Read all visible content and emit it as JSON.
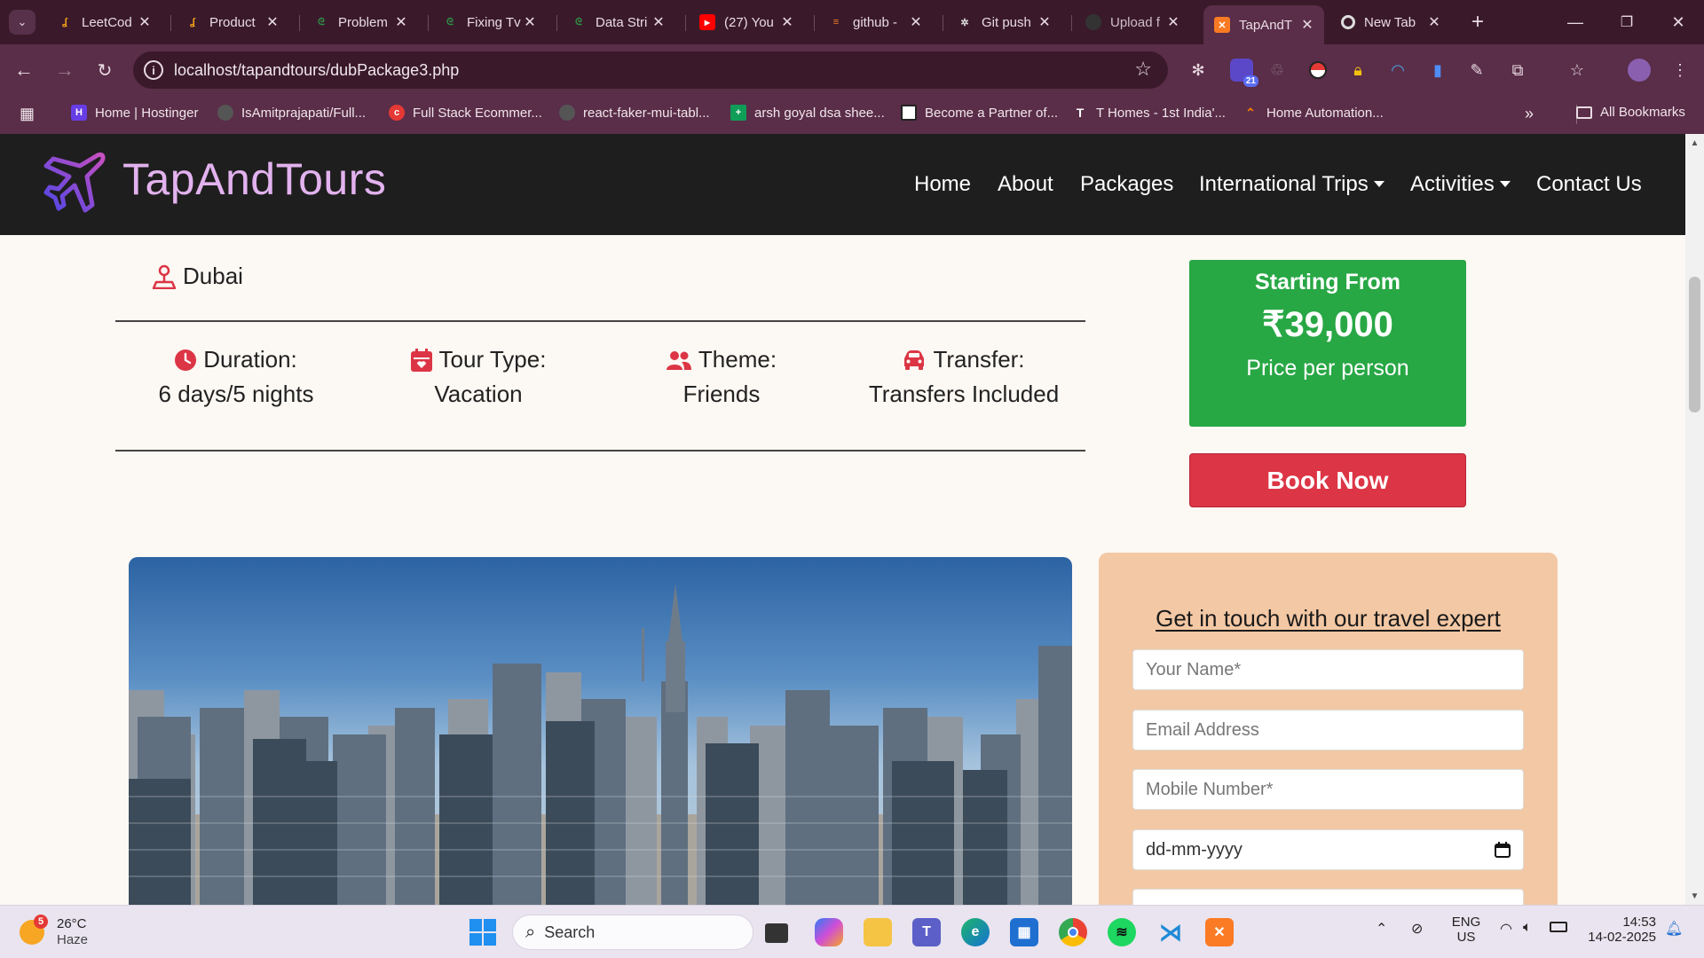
{
  "browser": {
    "tabs": [
      {
        "title": "LeetCod",
        "favicon": "leetcode-icon",
        "color": "#f7a21b"
      },
      {
        "title": "Product",
        "favicon": "leetcode-icon",
        "color": "#f7a21b"
      },
      {
        "title": "Problem",
        "favicon": "gfg-icon",
        "color": "#2f8d46"
      },
      {
        "title": "Fixing Tv",
        "favicon": "gfg-icon",
        "color": "#2f8d46"
      },
      {
        "title": "Data Stri",
        "favicon": "gfg-icon",
        "color": "#2f8d46"
      },
      {
        "title": "(27) You",
        "favicon": "youtube-icon",
        "color": "#ff0000"
      },
      {
        "title": "github -",
        "favicon": "stackoverflow-icon",
        "color": "#f48024"
      },
      {
        "title": "Git push",
        "favicon": "chatgpt-icon",
        "color": "#dddddd"
      },
      {
        "title": "Upload f",
        "favicon": "github-icon",
        "color": "#333333"
      },
      {
        "title": "TapAndT",
        "favicon": "xampp-icon",
        "color": "#fb7a24"
      },
      {
        "title": "New Tab",
        "favicon": "chrome-icon",
        "color": "#dddddd"
      }
    ],
    "url": "localhost/tapandtours/dubPackage3.php",
    "extension_badge": "21",
    "bookmarks": [
      {
        "label": "Home | Hostinger",
        "icon": "hostinger-icon",
        "color": "#673de6"
      },
      {
        "label": "IsAmitprajapati/Full...",
        "icon": "github-icon",
        "color": "#555555"
      },
      {
        "label": "Full Stack Ecommer...",
        "icon": "red-circle-icon",
        "color": "#e53935"
      },
      {
        "label": "react-faker-mui-tabl...",
        "icon": "github-icon",
        "color": "#555555"
      },
      {
        "label": "arsh goyal dsa shee...",
        "icon": "sheets-icon",
        "color": "#0f9d58"
      },
      {
        "label": "Become a Partner of...",
        "icon": "partner-icon",
        "color": "#222222"
      },
      {
        "label": "T Homes - 1st India'...",
        "icon": "thomes-icon",
        "color": "#111111"
      },
      {
        "label": "Home Automation...",
        "icon": "home-automation-icon",
        "color": "#f57c00"
      }
    ],
    "all_bookmarks_label": "All Bookmarks"
  },
  "site": {
    "brand": "TapAndTours",
    "nav": [
      "Home",
      "About",
      "Packages",
      "International Trips",
      "Activities",
      "Contact Us"
    ]
  },
  "package": {
    "location": "Dubai",
    "details": [
      {
        "icon": "clock-icon",
        "label": "Duration:",
        "value": "6 days/5 nights"
      },
      {
        "icon": "calendar-icon",
        "label": "Tour Type:",
        "value": "Vacation"
      },
      {
        "icon": "users-icon",
        "label": "Theme:",
        "value": "Friends"
      },
      {
        "icon": "car-icon",
        "label": "Transfer:",
        "value": "Transfers Included"
      }
    ],
    "price": {
      "heading": "Starting From",
      "amount": "₹39,000",
      "note": "Price per person"
    },
    "book_label": "Book Now"
  },
  "enquiry": {
    "title": "Get in touch with our travel expert",
    "fields": [
      {
        "placeholder": "Your Name*"
      },
      {
        "placeholder": "Email Address"
      },
      {
        "placeholder": "Mobile Number*"
      },
      {
        "placeholder": "dd-mm-yyyy"
      }
    ]
  },
  "taskbar": {
    "weather": {
      "temp": "26°C",
      "condition": "Haze",
      "badge": "5"
    },
    "search_label": "Search",
    "lang": "ENG",
    "region": "US",
    "time": "14:53",
    "date": "14-02-2025"
  },
  "colors": {
    "accent_green": "#28a745",
    "accent_red": "#dc3545",
    "brand_purple": "#e2b2ee",
    "header_bg": "#1e1e1e",
    "icon_red": "#dc3545"
  }
}
